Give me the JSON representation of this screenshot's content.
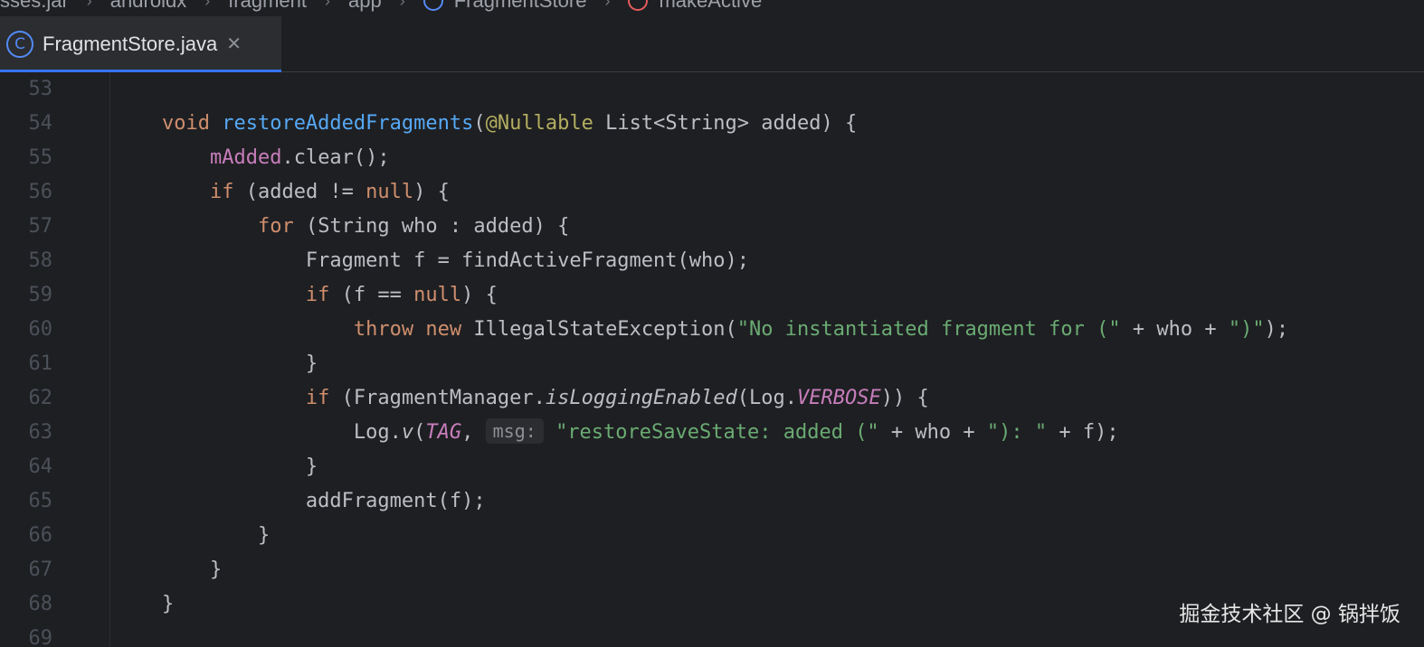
{
  "breadcrumb": [
    {
      "label": "sses.jar",
      "icon": ""
    },
    {
      "label": "androidx",
      "icon": ""
    },
    {
      "label": "fragment",
      "icon": ""
    },
    {
      "label": "app",
      "icon": ""
    },
    {
      "label": "FragmentStore",
      "icon": "class"
    },
    {
      "label": "makeActive",
      "icon": "method"
    }
  ],
  "breadcrumb_separator": "›",
  "tab": {
    "icon_glyph": "C",
    "label": "FragmentStore.java",
    "close_glyph": "✕"
  },
  "editor": {
    "lines": [
      {
        "n": "53",
        "tokens": []
      },
      {
        "n": "54",
        "tokens": [
          {
            "t": "    "
          },
          {
            "t": "void",
            "c": "kw"
          },
          {
            "t": " "
          },
          {
            "t": "restoreAddedFragments",
            "c": "fn"
          },
          {
            "t": "("
          },
          {
            "t": "@Nullable",
            "c": "ann"
          },
          {
            "t": " List<String> added) {"
          }
        ]
      },
      {
        "n": "55",
        "tokens": [
          {
            "t": "        "
          },
          {
            "t": "mAdded",
            "c": "fld"
          },
          {
            "t": ".clear();"
          }
        ]
      },
      {
        "n": "56",
        "tokens": [
          {
            "t": "        "
          },
          {
            "t": "if",
            "c": "kw"
          },
          {
            "t": " (added != "
          },
          {
            "t": "null",
            "c": "kw"
          },
          {
            "t": ") {"
          }
        ]
      },
      {
        "n": "57",
        "tokens": [
          {
            "t": "            "
          },
          {
            "t": "for",
            "c": "kw"
          },
          {
            "t": " (String who : added) {"
          }
        ]
      },
      {
        "n": "58",
        "tokens": [
          {
            "t": "                Fragment f = findActiveFragment(who);"
          }
        ]
      },
      {
        "n": "59",
        "tokens": [
          {
            "t": "                "
          },
          {
            "t": "if",
            "c": "kw"
          },
          {
            "t": " (f == "
          },
          {
            "t": "null",
            "c": "kw"
          },
          {
            "t": ") {"
          }
        ]
      },
      {
        "n": "60",
        "tokens": [
          {
            "t": "                    "
          },
          {
            "t": "throw",
            "c": "kw"
          },
          {
            "t": " "
          },
          {
            "t": "new",
            "c": "kw"
          },
          {
            "t": " IllegalStateException("
          },
          {
            "t": "\"No instantiated fragment for (\"",
            "c": "str"
          },
          {
            "t": " + who + "
          },
          {
            "t": "\")\"",
            "c": "str"
          },
          {
            "t": ");"
          }
        ]
      },
      {
        "n": "61",
        "tokens": [
          {
            "t": "                }"
          }
        ]
      },
      {
        "n": "62",
        "tokens": [
          {
            "t": "                "
          },
          {
            "t": "if",
            "c": "kw"
          },
          {
            "t": " (FragmentManager."
          },
          {
            "t": "isLoggingEnabled",
            "c": "sfn"
          },
          {
            "t": "(Log."
          },
          {
            "t": "VERBOSE",
            "c": "sfld"
          },
          {
            "t": ")) {"
          }
        ]
      },
      {
        "n": "63",
        "tokens": [
          {
            "t": "                    Log."
          },
          {
            "t": "v",
            "c": "sfn"
          },
          {
            "t": "("
          },
          {
            "t": "TAG",
            "c": "sfld"
          },
          {
            "t": ", "
          },
          {
            "t": "msg:",
            "c": "hint"
          },
          {
            "t": " "
          },
          {
            "t": "\"restoreSaveState: added (\"",
            "c": "str"
          },
          {
            "t": " + who + "
          },
          {
            "t": "\"): \"",
            "c": "str"
          },
          {
            "t": " + f);"
          }
        ]
      },
      {
        "n": "64",
        "tokens": [
          {
            "t": "                }"
          }
        ]
      },
      {
        "n": "65",
        "tokens": [
          {
            "t": "                addFragment(f);"
          }
        ]
      },
      {
        "n": "66",
        "tokens": [
          {
            "t": "            }"
          }
        ]
      },
      {
        "n": "67",
        "tokens": [
          {
            "t": "        }"
          }
        ]
      },
      {
        "n": "68",
        "tokens": [
          {
            "t": "    }"
          }
        ]
      },
      {
        "n": "69",
        "tokens": []
      }
    ]
  },
  "watermark": "掘金技术社区 @ 锅拌饭",
  "colors": {
    "background": "#1e1f22",
    "keyword": "#cf8e6d",
    "function": "#56a8f5",
    "annotation": "#b3ae60",
    "field": "#c77dbb",
    "string": "#6aab73",
    "accent": "#3574f0"
  }
}
